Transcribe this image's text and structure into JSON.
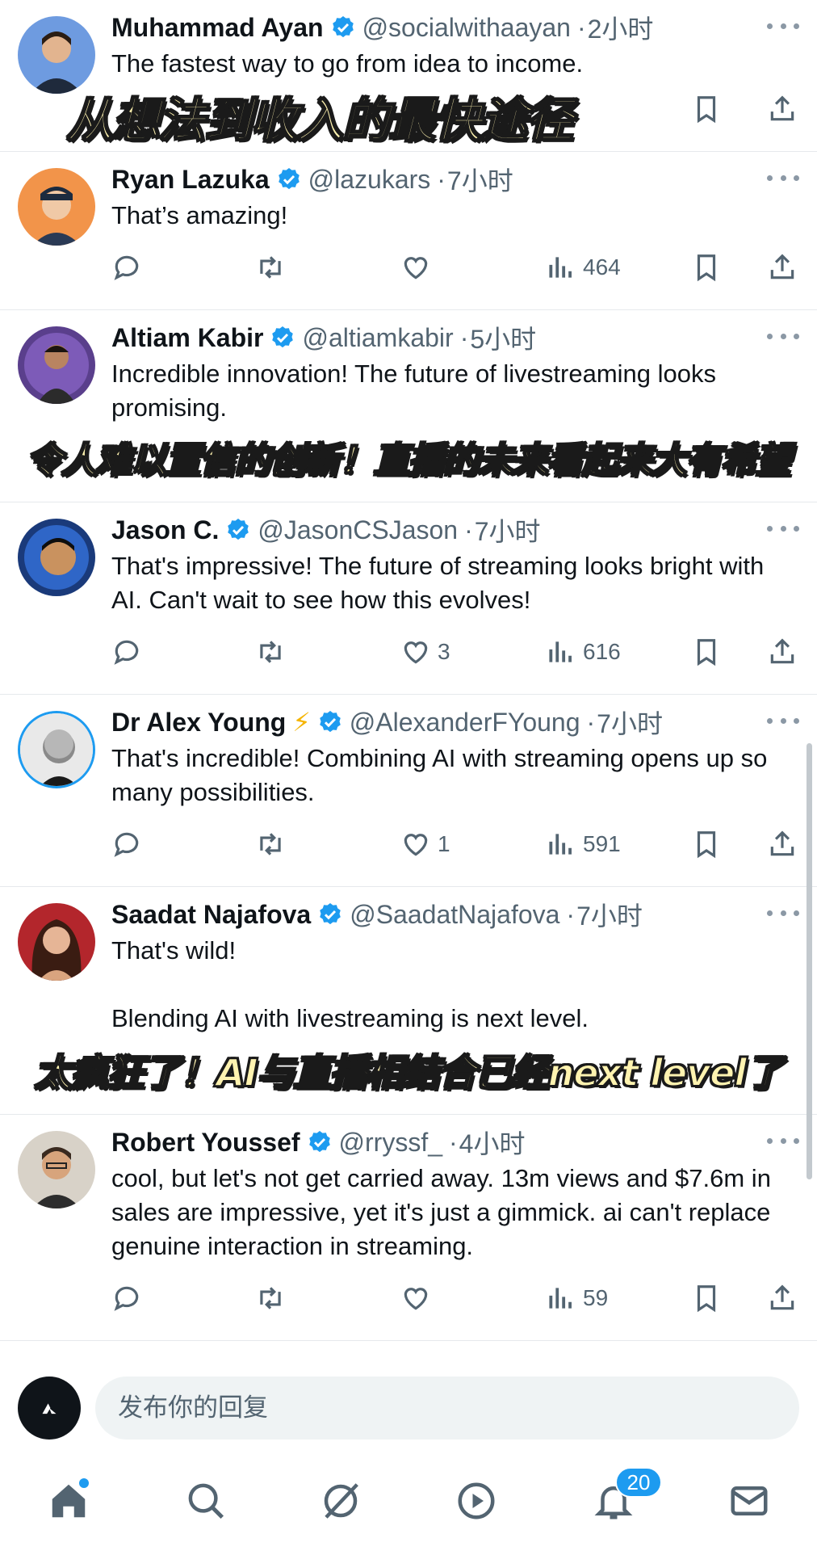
{
  "tweets": [
    {
      "name": "Muhammad Ayan",
      "handle": "@socialwithaayan",
      "time": "2小时",
      "text": "The fastest way to go from idea to income.",
      "subtitle": "从想法到收入的最快途径",
      "replies": "",
      "retweets": "",
      "likes": "",
      "views": ""
    },
    {
      "name": "Ryan Lazuka",
      "handle": "@lazukars",
      "time": "7小时",
      "text": "That’s amazing!",
      "replies": "",
      "retweets": "",
      "likes": "",
      "views": "464"
    },
    {
      "name": "Altiam Kabir",
      "handle": "@altiamkabir",
      "time": "5小时",
      "text": "Incredible innovation! The future of livestreaming looks promising.",
      "subtitle": "令人难以置信的创新！直播的未来看起来大有希望",
      "replies": "",
      "retweets": "",
      "likes": "",
      "views": ""
    },
    {
      "name": "Jason C.",
      "handle": "@JasonCSJason",
      "time": "7小时",
      "text": "That's impressive! The future of streaming looks bright with AI. Can't wait to see how this evolves!",
      "replies": "",
      "retweets": "",
      "likes": "3",
      "views": "616"
    },
    {
      "name": "Dr Alex Young",
      "handle": "@AlexanderFYoung",
      "time": "7小时",
      "text": "That's incredible! Combining AI with streaming opens up so many possibilities.",
      "replies": "",
      "retweets": "",
      "likes": "1",
      "views": "591"
    },
    {
      "name": "Saadat Najafova",
      "handle": "@SaadatNajafova",
      "time": "7小时",
      "text": "That's wild!\n\nBlending AI with livestreaming is next level.",
      "subtitle": "太疯狂了！AI与直播相结合已经next level了",
      "replies": "",
      "retweets": "",
      "likes": "",
      "views": ""
    },
    {
      "name": "Robert Youssef",
      "handle": "@rryssf_",
      "time": "4小时",
      "text": "cool, but let's not get carried away. 13m views and $7.6m in sales are impressive, yet it's just a gimmick. ai can't replace genuine interaction in streaming.",
      "replies": "",
      "retweets": "",
      "likes": "",
      "views": "59"
    }
  ],
  "reply_bar": {
    "placeholder": "发布你的回复"
  },
  "tabbar": {
    "notifications_badge": "20"
  },
  "colors": {
    "accent": "#1d9bf0",
    "text": "#0f1419",
    "muted": "#536471",
    "divider": "#e6e9ec"
  }
}
